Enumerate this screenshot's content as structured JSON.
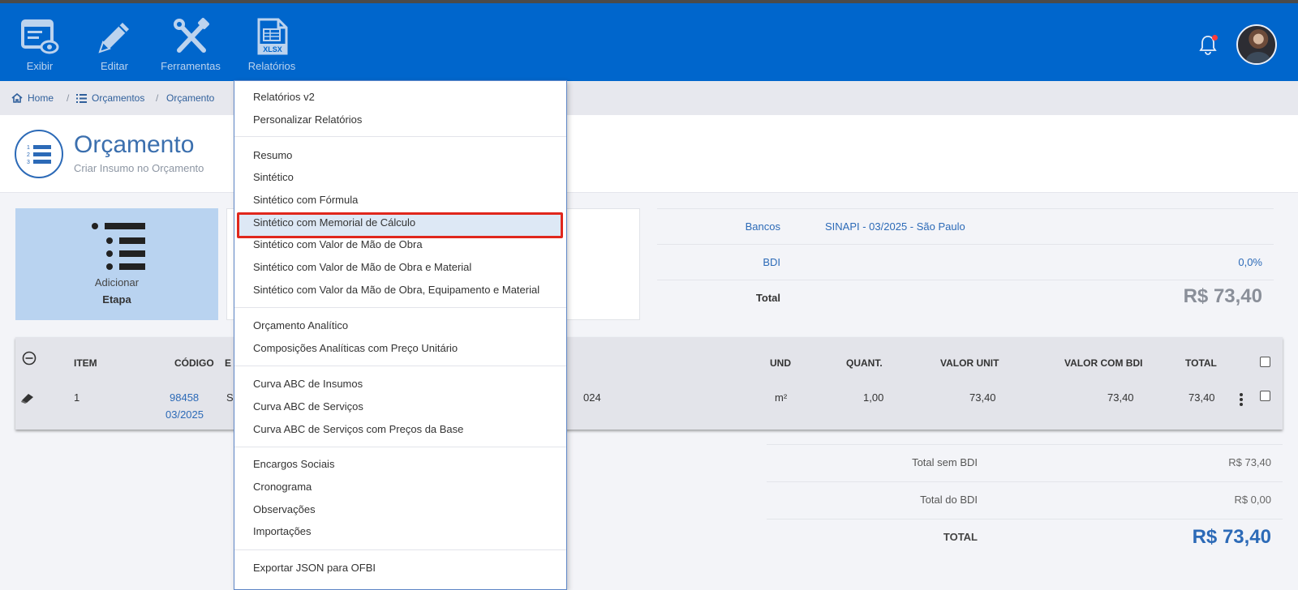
{
  "nav": {
    "exibir": "Exibir",
    "editar": "Editar",
    "ferramentas": "Ferramentas",
    "relatorios": "Relatórios",
    "xlsx_badge": "XLSX"
  },
  "breadcrumb": {
    "home": "Home",
    "orcamentos": "Orçamentos",
    "orcamento": "Orçamento"
  },
  "page": {
    "title": "Orçamento",
    "subtitle": "Criar Insumo no Orçamento"
  },
  "add_card": {
    "line1": "Adicionar",
    "line2": "Etapa"
  },
  "summary": {
    "bancos_label": "Bancos",
    "bancos_value": "SINAPI - 03/2025 - São Paulo",
    "bdi_label": "BDI",
    "bdi_value": "0,0%",
    "total_label": "Total",
    "total_value": "R$ 73,40"
  },
  "table": {
    "headers": {
      "item": "ITEM",
      "codigo": "CÓDIGO",
      "desc_partial": "E",
      "und": "UND",
      "quant": "QUANT.",
      "valor_unit": "VALOR UNIT",
      "valor_bdi": "VALOR COM BDI",
      "total": "TOTAL"
    },
    "row": {
      "item": "1",
      "codigo": "98458",
      "codigo_date": "03/2025",
      "desc_start": "S",
      "desc_end": "024",
      "und": "m²",
      "quant": "1,00",
      "valor_unit": "73,40",
      "valor_bdi": "73,40",
      "total": "73,40"
    }
  },
  "totals": {
    "sem_bdi_label": "Total sem BDI",
    "sem_bdi_value": "R$ 73,40",
    "do_bdi_label": "Total do BDI",
    "do_bdi_value": "R$ 0,00",
    "total_label": "TOTAL",
    "total_value": "R$ 73,40"
  },
  "menu": {
    "items": [
      "Relatórios v2",
      "Personalizar Relatórios",
      "Resumo",
      "Sintético",
      "Sintético com Fórmula",
      "Sintético com Memorial de Cálculo",
      "Sintético com Valor de Mão de Obra",
      "Sintético com Valor de Mão de Obra e Material",
      "Sintético com Valor da Mão de Obra, Equipamento e Material",
      "Orçamento Analítico",
      "Composições Analíticas com Preço Unitário",
      "Curva ABC de Insumos",
      "Curva ABC de Serviços",
      "Curva ABC de Serviços com Preços da Base",
      "Encargos Sociais",
      "Cronograma",
      "Observações",
      "Importações",
      "Exportar JSON para OFBI"
    ]
  },
  "colors": {
    "appbar": "#0066cc",
    "accent": "#2c6ab7",
    "highlight_border": "#e0271c"
  }
}
